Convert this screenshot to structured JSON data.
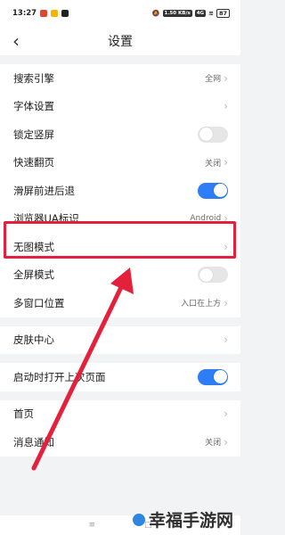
{
  "status_bar": {
    "time": "13:27",
    "net_speed": "1.50 KB/s",
    "network": "4G",
    "battery": "87"
  },
  "header": {
    "back_icon": "chevron-left-icon",
    "title": "设置"
  },
  "groups": [
    {
      "rows": [
        {
          "name": "search-engine",
          "label": "搜索引擎",
          "value": "全网",
          "control": "chevron"
        },
        {
          "name": "font-settings",
          "label": "字体设置",
          "value": "",
          "control": "chevron"
        },
        {
          "name": "lock-portrait",
          "label": "锁定竖屏",
          "value": "",
          "control": "toggle",
          "on": false
        },
        {
          "name": "quick-page-turn",
          "label": "快速翻页",
          "value": "关闭",
          "control": "chevron"
        },
        {
          "name": "swipe-nav",
          "label": "滑屏前进后退",
          "value": "",
          "control": "toggle",
          "on": true
        },
        {
          "name": "browser-ua",
          "label": "浏览器UA标识",
          "value": "Android",
          "control": "chevron"
        },
        {
          "name": "no-image-mode",
          "label": "无图模式",
          "value": "",
          "control": "chevron"
        },
        {
          "name": "fullscreen-mode",
          "label": "全屏模式",
          "value": "",
          "control": "toggle",
          "on": false
        },
        {
          "name": "multiwindow-position",
          "label": "多窗口位置",
          "value": "入口在上方",
          "control": "chevron"
        }
      ]
    },
    {
      "rows": [
        {
          "name": "skin-center",
          "label": "皮肤中心",
          "value": "",
          "control": "chevron"
        }
      ]
    },
    {
      "rows": [
        {
          "name": "open-last-page",
          "label": "启动时打开上次页面",
          "value": "",
          "control": "toggle",
          "on": true
        }
      ]
    },
    {
      "rows": [
        {
          "name": "home-page",
          "label": "首页",
          "value": "",
          "control": "chevron"
        },
        {
          "name": "message-notify",
          "label": "消息通知",
          "value": "关闭",
          "control": "chevron"
        }
      ]
    }
  ],
  "annotation": {
    "highlight_color": "#e5203c",
    "arrow_color": "#e5203c"
  },
  "watermark": {
    "text": "幸福手游网"
  },
  "colors": {
    "accent": "#2d7df6"
  }
}
